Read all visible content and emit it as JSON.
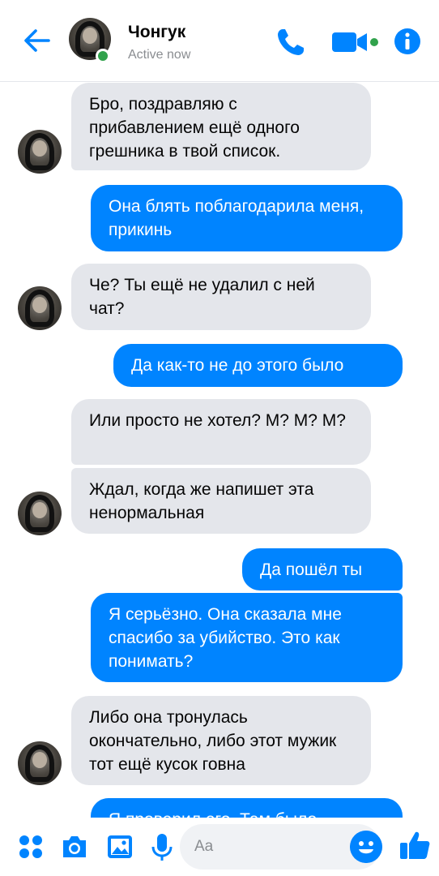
{
  "header": {
    "name": "Чонгук",
    "status": "Active now",
    "accent": "#0084ff",
    "online_color": "#31a24c",
    "icons": [
      "back-arrow-icon",
      "phone-icon",
      "video-camera-icon",
      "info-icon"
    ]
  },
  "messages": [
    {
      "from": "them",
      "text": "Бро, поздравляю с прибавлением ещё одного грешника в твой список."
    },
    {
      "from": "me",
      "text": "Она блять поблагодарила меня, прикинь"
    },
    {
      "from": "them",
      "text": "Че? Ты ещё не удалил с ней чат?"
    },
    {
      "from": "me",
      "text": "Да как-то не до этого было"
    },
    {
      "from": "them",
      "text": "Или просто не хотел? М? М? М?"
    },
    {
      "from": "them",
      "text": "Ждал, когда же напишет эта ненормальная"
    },
    {
      "from": "me",
      "text": "Да пошёл ты"
    },
    {
      "from": "me",
      "text": "Я серьёзно. Она сказала мне спасибо за убийство. Это как понимать?"
    },
    {
      "from": "them",
      "text": "Либо она тронулась окончательно, либо этот мужик тот ещё кусок говна"
    },
    {
      "from": "me",
      "text": "Я проверил его. Там было"
    }
  ],
  "composer": {
    "placeholder": "Aa",
    "icons": [
      "apps-icon",
      "camera-icon",
      "gallery-icon",
      "microphone-icon",
      "emoji-icon",
      "thumbs-up-icon"
    ]
  }
}
